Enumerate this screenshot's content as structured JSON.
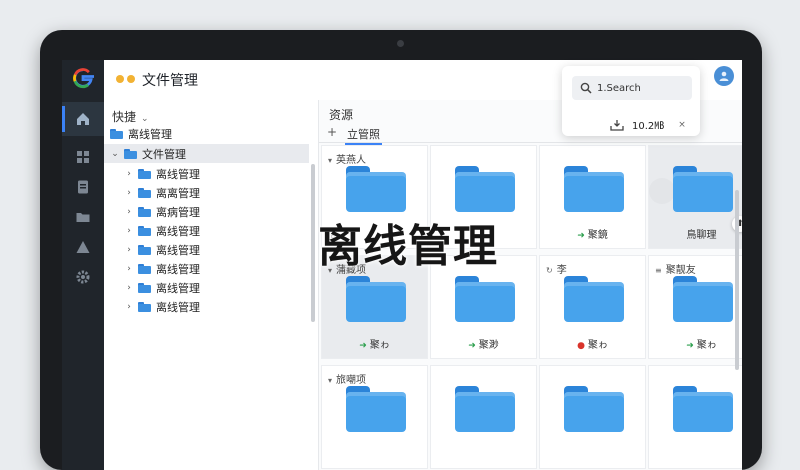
{
  "window": {
    "title": "文件管理",
    "dot_colors": [
      "#f2b233",
      "#f2b233"
    ]
  },
  "sidebar": {
    "header": "快捷",
    "tree": [
      {
        "label": "离线管理",
        "level": 0,
        "chevron": ""
      },
      {
        "label": "文件管理",
        "level": 0,
        "chevron": "⌄",
        "selected": true
      },
      {
        "label": "离线管理",
        "level": 1,
        "chevron": "›"
      },
      {
        "label": "离离管理",
        "level": 1,
        "chevron": "›"
      },
      {
        "label": "离病管理",
        "level": 1,
        "chevron": "›"
      },
      {
        "label": "离线管理",
        "level": 1,
        "chevron": "›"
      },
      {
        "label": "离线管理",
        "level": 1,
        "chevron": "›"
      },
      {
        "label": "离线管理",
        "level": 1,
        "chevron": "›"
      },
      {
        "label": "离线管理",
        "level": 1,
        "chevron": "›"
      },
      {
        "label": "离线管理",
        "level": 1,
        "chevron": "›"
      }
    ]
  },
  "content": {
    "header": "资源",
    "tab_add": "+",
    "tab_label": "立管照",
    "rows": [
      [
        {
          "tag": "英燕人",
          "tag_icon": "▾",
          "name": "",
          "arrow": "none"
        },
        {
          "tag": "",
          "name": "",
          "arrow": "none"
        },
        {
          "tag": "",
          "name": "聚鏡",
          "arrow": "green"
        },
        {
          "tag": "",
          "name": "鳥聊理",
          "arrow": "none",
          "hl": true,
          "ghost": true,
          "badge": "⬆"
        }
      ],
      [
        {
          "tag": "蒲藏项",
          "tag_icon": "▾",
          "name": "聚ゎ",
          "arrow": "green",
          "hl": true
        },
        {
          "tag": "",
          "name": "聚渺",
          "arrow": "green"
        },
        {
          "tag": "李",
          "tag_icon": "↻",
          "name": "聚ゎ",
          "arrow": "red"
        },
        {
          "tag": "聚靓友",
          "tag_icon": "≡",
          "name": "聚ゎ",
          "arrow": "green"
        }
      ],
      [
        {
          "tag": "旅嘲项",
          "tag_icon": "▾",
          "name": "",
          "arrow": "none"
        },
        {
          "tag": "",
          "name": "",
          "arrow": "none"
        },
        {
          "tag": "",
          "name": "",
          "arrow": "none"
        },
        {
          "tag": "",
          "name": "",
          "arrow": "none"
        }
      ]
    ],
    "row0_corner_label": "亀"
  },
  "search": {
    "value": "1.Search",
    "speed": "10.2㎆",
    "close": "×"
  },
  "overlay": {
    "title": "离线管理"
  },
  "icons": {
    "rail": [
      "home-icon",
      "grid-icon",
      "document-icon",
      "folder-icon",
      "alert-icon",
      "settings-icon"
    ]
  }
}
